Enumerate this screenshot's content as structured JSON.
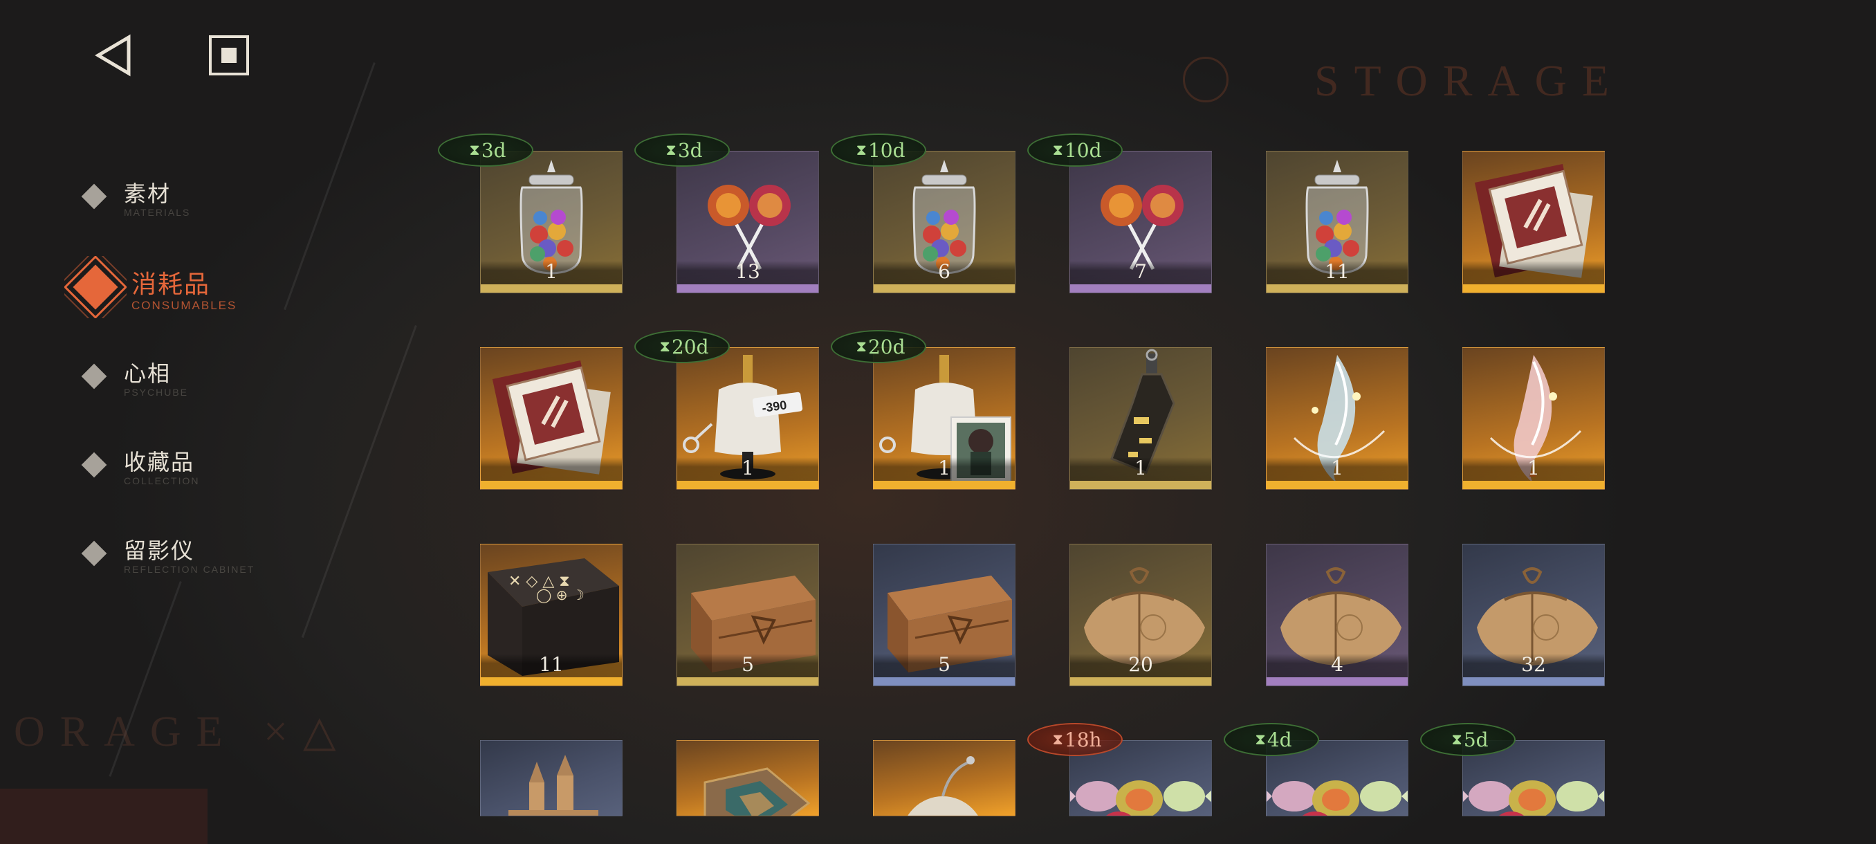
{
  "background": {
    "storage_title": "STORAGE",
    "storage_left": "ORAGE ×△"
  },
  "nav": {
    "back_icon": "back-triangle-icon",
    "home_icon": "home-square-icon"
  },
  "sidebar": {
    "items": [
      {
        "label": "素材",
        "sub": "MATERIALS",
        "active": false
      },
      {
        "label": "消耗品",
        "sub": "CONSUMABLES",
        "active": true
      },
      {
        "label": "心相",
        "sub": "PSYCHUBE",
        "active": false
      },
      {
        "label": "收藏品",
        "sub": "COLLECTION",
        "active": false
      },
      {
        "label": "留影仪",
        "sub": "REFLECTION CABINET",
        "active": false
      }
    ]
  },
  "colors": {
    "accent": "#e5673a",
    "timer_green": "#a9de92",
    "timer_red": "#f0b09a"
  },
  "inventory": {
    "rows": [
      [
        {
          "icon": "candy-jar-icon",
          "qty": "1",
          "timer": "3d",
          "rarity": "gold"
        },
        {
          "icon": "lollipop-icon",
          "qty": "13",
          "timer": "3d",
          "rarity": "purple"
        },
        {
          "icon": "candy-jar-icon",
          "qty": "6",
          "timer": "10d",
          "rarity": "gold"
        },
        {
          "icon": "lollipop-icon",
          "qty": "7",
          "timer": "10d",
          "rarity": "purple"
        },
        {
          "icon": "candy-jar-icon",
          "qty": "11",
          "timer": "",
          "rarity": "gold"
        },
        {
          "icon": "document-pack-icon",
          "qty": "",
          "timer": "",
          "rarity": "orange"
        }
      ],
      [
        {
          "icon": "document-pack-icon",
          "qty": "",
          "timer": "",
          "rarity": "orange"
        },
        {
          "icon": "mannequin-outfit-icon",
          "qty": "1",
          "timer": "20d",
          "rarity": "orange"
        },
        {
          "icon": "mannequin-portrait-icon",
          "qty": "1",
          "timer": "20d",
          "rarity": "orange"
        },
        {
          "icon": "bottle-icon",
          "qty": "1",
          "timer": "",
          "rarity": "gold"
        },
        {
          "icon": "crystal-spiral-icon",
          "qty": "1",
          "timer": "",
          "rarity": "orange"
        },
        {
          "icon": "flame-spiral-icon",
          "qty": "1",
          "timer": "",
          "rarity": "orange"
        }
      ],
      [
        {
          "icon": "rune-box-icon",
          "qty": "11",
          "timer": "",
          "rarity": "orange"
        },
        {
          "icon": "wooden-crate-icon",
          "qty": "5",
          "timer": "",
          "rarity": "gold"
        },
        {
          "icon": "wooden-crate-icon",
          "qty": "5",
          "timer": "",
          "rarity": "blue"
        },
        {
          "icon": "cloth-bundle-icon",
          "qty": "20",
          "timer": "",
          "rarity": "gold"
        },
        {
          "icon": "cloth-bundle-icon",
          "qty": "4",
          "timer": "",
          "rarity": "purple"
        },
        {
          "icon": "cloth-bundle-icon",
          "qty": "32",
          "timer": "",
          "rarity": "blue"
        }
      ],
      [
        {
          "icon": "sandcastle-icon",
          "qty": "",
          "timer": "",
          "rarity": "blue"
        },
        {
          "icon": "puzzle-box-icon",
          "qty": "",
          "timer": "",
          "rarity": "orange"
        },
        {
          "icon": "mask-bomb-icon",
          "qty": "",
          "timer": "",
          "rarity": "orange"
        },
        {
          "icon": "wrapped-candies-icon",
          "qty": "",
          "timer": "18h",
          "timer_color": "red",
          "rarity": "blue"
        },
        {
          "icon": "wrapped-candies-icon",
          "qty": "",
          "timer": "4d",
          "rarity": "blue"
        },
        {
          "icon": "wrapped-candies-icon",
          "qty": "",
          "timer": "5d",
          "rarity": "blue"
        }
      ]
    ]
  }
}
